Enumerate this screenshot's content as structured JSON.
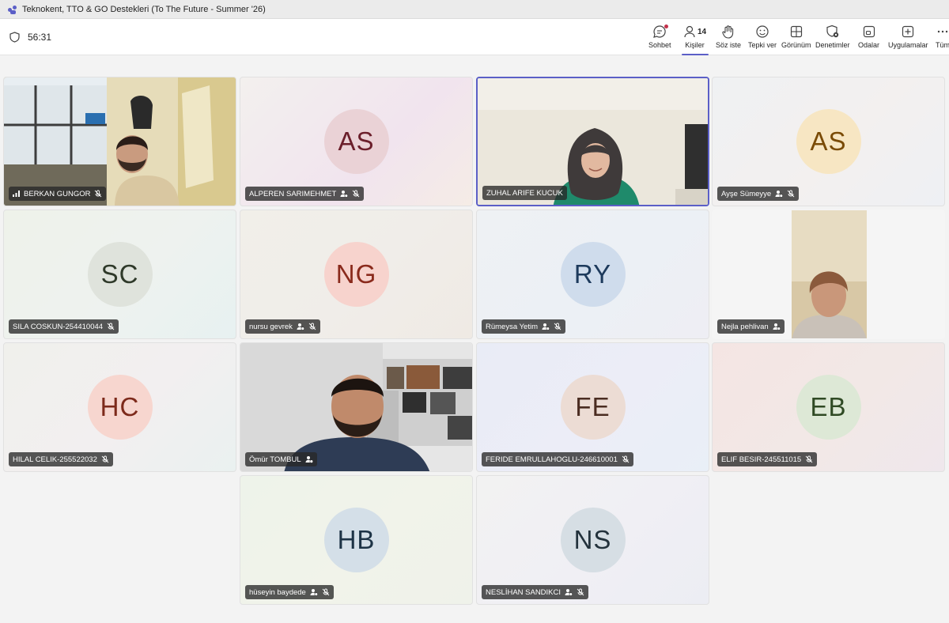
{
  "window": {
    "title": "Teknokent, TTO & GO Destekleri (To The Future - Summer '26)"
  },
  "meeting": {
    "timer": "56:31"
  },
  "toolbar": {
    "chat": "Sohbet",
    "people": "Kişiler",
    "people_count": "14",
    "raise": "Söz iste",
    "react": "Tepki ver",
    "view": "Görünüm",
    "controls": "Denetimler",
    "rooms": "Odalar",
    "apps": "Uygulamalar",
    "more": "Tüm"
  },
  "colors": {
    "accent": "#5b5fc7",
    "nametag_bg": "#2b2b2b"
  },
  "participants": [
    {
      "name": "BERKAN GUNGOR",
      "type": "video"
    },
    {
      "name": "ALPEREN SARIMEHMET",
      "initials": "AS",
      "avatar_bg": "#ead2d6",
      "avatar_fg": "#6b1f2b"
    },
    {
      "name": "ZUHAL ARIFE KUCUK",
      "type": "video"
    },
    {
      "name": "Ayşe Sümeyye",
      "initials": "AS",
      "avatar_bg": "#f7e6c3",
      "avatar_fg": "#7a4b06"
    },
    {
      "name": "SILA COSKUN-254410044",
      "initials": "SC",
      "avatar_bg": "#dfe3dc",
      "avatar_fg": "#2f3a2a"
    },
    {
      "name": "nursu gevrek",
      "initials": "NG",
      "avatar_bg": "#f7d3cd",
      "avatar_fg": "#8a2a1c"
    },
    {
      "name": "Rümeysa Yetim",
      "initials": "RY",
      "avatar_bg": "#cfdcec",
      "avatar_fg": "#1d3a5c"
    },
    {
      "name": "Nejla pehlivan",
      "type": "video"
    },
    {
      "name": "HILAL CELIK-255522032",
      "initials": "HC",
      "avatar_bg": "#f7d6cf",
      "avatar_fg": "#7d2a1b"
    },
    {
      "name": "Ömür TOMBUL",
      "type": "video"
    },
    {
      "name": "FERIDE EMRULLAHOGLU-246610001",
      "initials": "FE",
      "avatar_bg": "#ecdcd4",
      "avatar_fg": "#4a2c21"
    },
    {
      "name": "ELIF BESIR-245511015",
      "initials": "EB",
      "avatar_bg": "#dde8d6",
      "avatar_fg": "#2f4a24"
    },
    {
      "name": "hüseyin baydede",
      "initials": "HB",
      "avatar_bg": "#d4dfe8",
      "avatar_fg": "#1d3346"
    },
    {
      "name": "NESLİHAN SANDIKCI",
      "initials": "NS",
      "avatar_bg": "#d6dee4",
      "avatar_fg": "#23323c"
    }
  ]
}
